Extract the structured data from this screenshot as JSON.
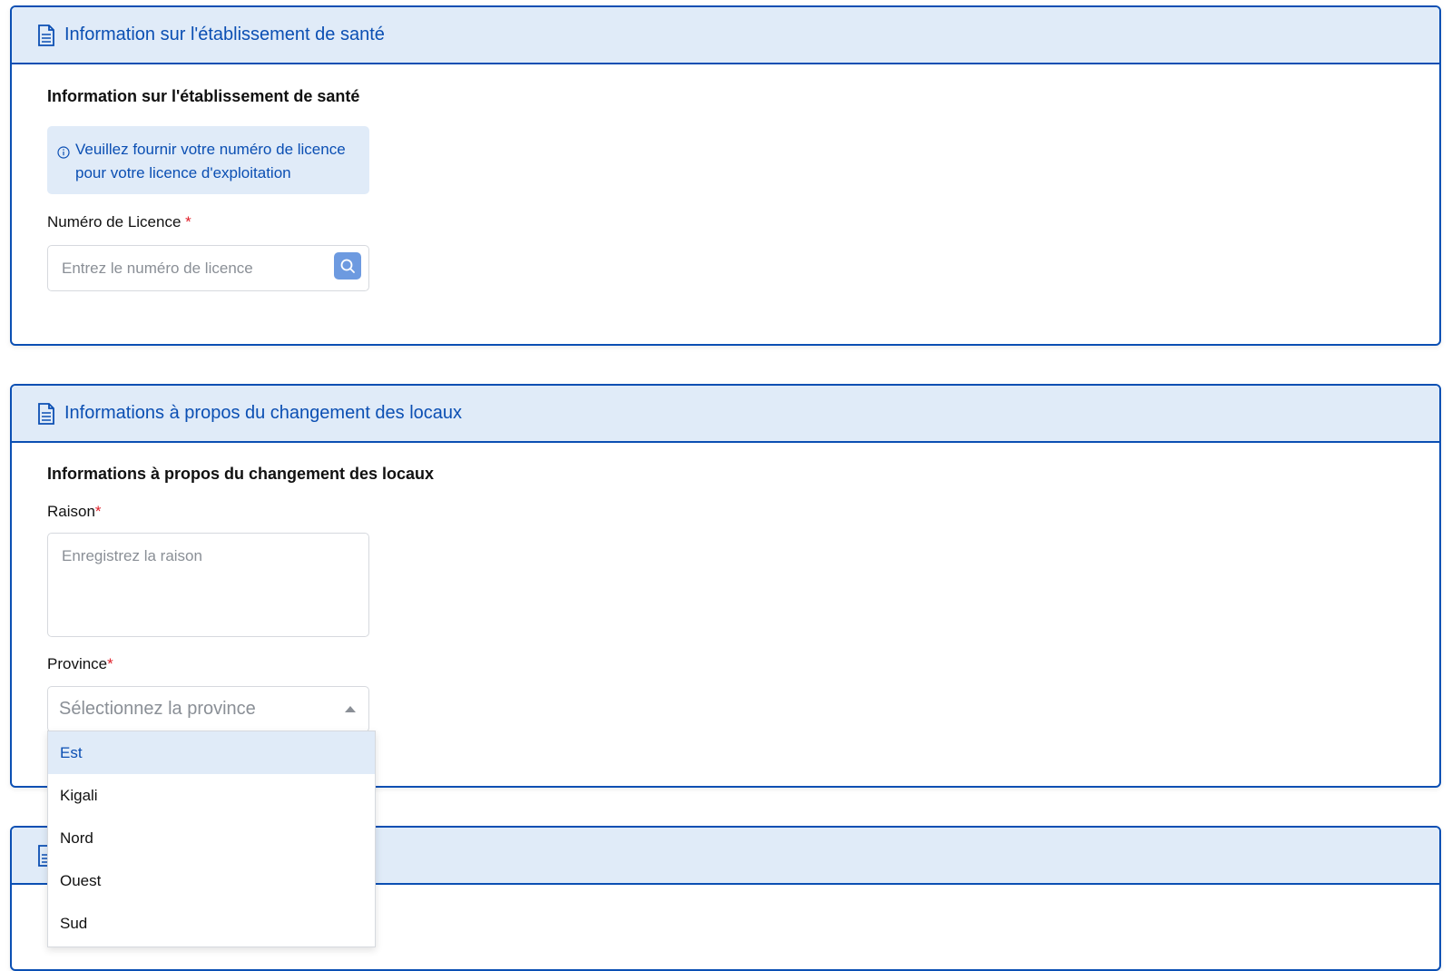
{
  "section1": {
    "header_title": "Information sur l'établissement de santé",
    "subtitle": "Information sur l'établissement de santé",
    "info_message": "Veuillez fournir votre numéro de licence pour votre licence d'exploitation",
    "license_label": "Numéro de Licence",
    "license_required": "*",
    "license_placeholder": "Entrez le numéro de licence"
  },
  "section2": {
    "header_title": "Informations à propos du changement des locaux",
    "subtitle": "Informations à propos du changement des locaux",
    "reason_label": "Raison",
    "reason_required": "*",
    "reason_placeholder": "Enregistrez la raison",
    "province_label": "Province",
    "province_required": "*",
    "province_placeholder": "Sélectionnez la province",
    "province_options": [
      "Est",
      "Kigali",
      "Nord",
      "Ouest",
      "Sud"
    ],
    "province_highlighted": "Est"
  },
  "colors": {
    "accent": "#0b4fb3",
    "header_bg": "#e0ebf8",
    "required": "#e0202a",
    "search_button": "#6d9ae0"
  },
  "icons": {
    "header": "document-icon",
    "info": "info-circle-icon",
    "search": "search-icon",
    "dropdown": "caret-up-icon"
  }
}
